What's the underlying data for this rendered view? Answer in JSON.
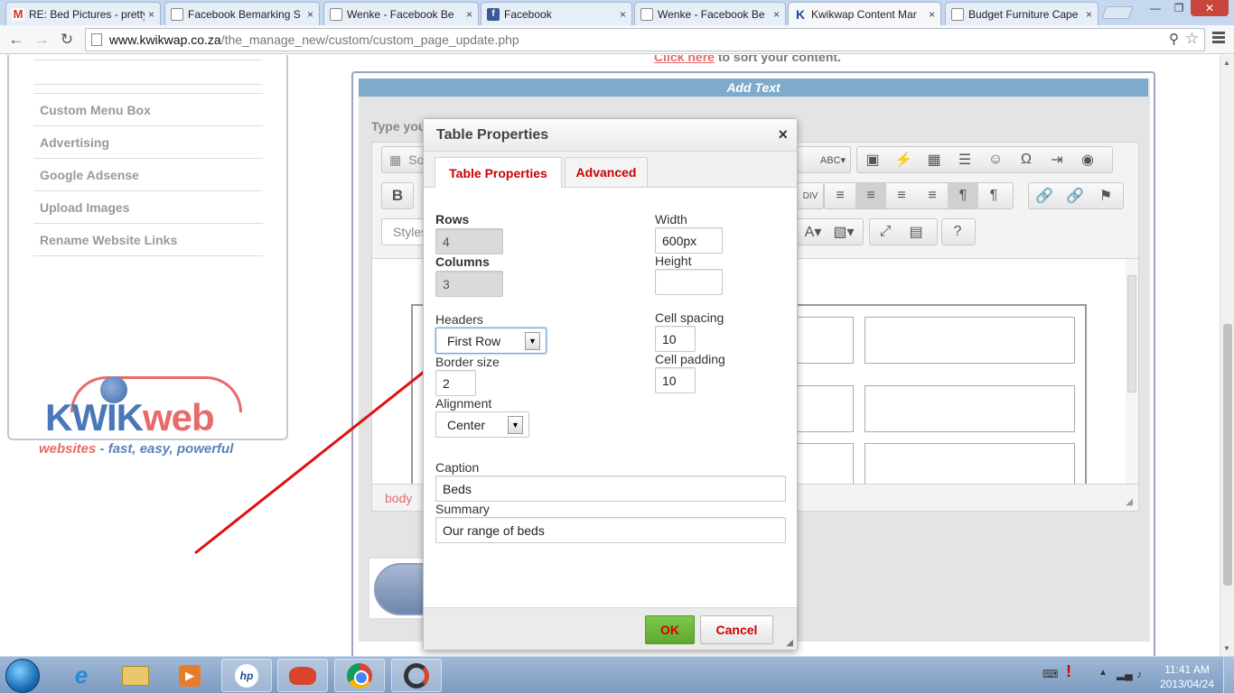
{
  "browser": {
    "tabs": [
      {
        "title": "RE: Bed Pictures - pretty",
        "icon": "gmail-icon"
      },
      {
        "title": "Facebook Bemarking S",
        "icon": "document-icon"
      },
      {
        "title": "Wenke - Facebook Be",
        "icon": "document-icon"
      },
      {
        "title": "Facebook",
        "icon": "facebook-icon"
      },
      {
        "title": "Wenke - Facebook Be",
        "icon": "document-icon"
      },
      {
        "title": "Kwikwap Content Mar",
        "icon": "kwikwap-icon",
        "active": true
      },
      {
        "title": "Budget Furniture Cape",
        "icon": "document-icon"
      }
    ],
    "tab_close_glyph": "×",
    "url_host": "www.kwikwap.co.za",
    "url_path": "/the_manage_new/custom/custom_page_update.php"
  },
  "sidebar": {
    "items": [
      {
        "label": "Custom Menu Box"
      },
      {
        "label": "Advertising"
      },
      {
        "label": "Google Adsense"
      },
      {
        "label": "Upload Images"
      },
      {
        "label": "Rename Website Links"
      }
    ],
    "logo": {
      "kwik": "KWIK",
      "web": "web",
      "tagline_lead": "websites",
      "tagline_rest": " - fast, easy, powerful"
    }
  },
  "main": {
    "sort_link": "Click here",
    "sort_text": " to sort your content.",
    "panel_title": "Add Text",
    "type_label": "Type you",
    "source_label": "So",
    "styles_label": "Styles",
    "bold_label": "B",
    "path_label": "body"
  },
  "dialog": {
    "title": "Table Properties",
    "close_glyph": "×",
    "tabs": [
      {
        "label": "Table Properties",
        "active": true
      },
      {
        "label": "Advanced",
        "active": false
      }
    ],
    "fields": {
      "rows": {
        "label": "Rows",
        "value": "4"
      },
      "columns": {
        "label": "Columns",
        "value": "3"
      },
      "width": {
        "label": "Width",
        "value": "600px"
      },
      "height": {
        "label": "Height",
        "value": ""
      },
      "headers": {
        "label": "Headers",
        "value": "First Row"
      },
      "border_size": {
        "label": "Border size",
        "value": "2"
      },
      "cell_spacing": {
        "label": "Cell spacing",
        "value": "10"
      },
      "cell_padding": {
        "label": "Cell padding",
        "value": "10"
      },
      "alignment": {
        "label": "Alignment",
        "value": "Center"
      },
      "caption": {
        "label": "Caption",
        "value": "Beds"
      },
      "summary": {
        "label": "Summary",
        "value": "Our range of beds"
      }
    },
    "ok_label": "OK",
    "cancel_label": "Cancel"
  },
  "taskbar": {
    "time": "11:41 AM",
    "date": "2013/04/24"
  },
  "colors": {
    "accent_red": "#cc0000",
    "panel_blue": "#7faacb",
    "ok_green": "#5fa82f",
    "annotation_arrow": "#e01010"
  }
}
